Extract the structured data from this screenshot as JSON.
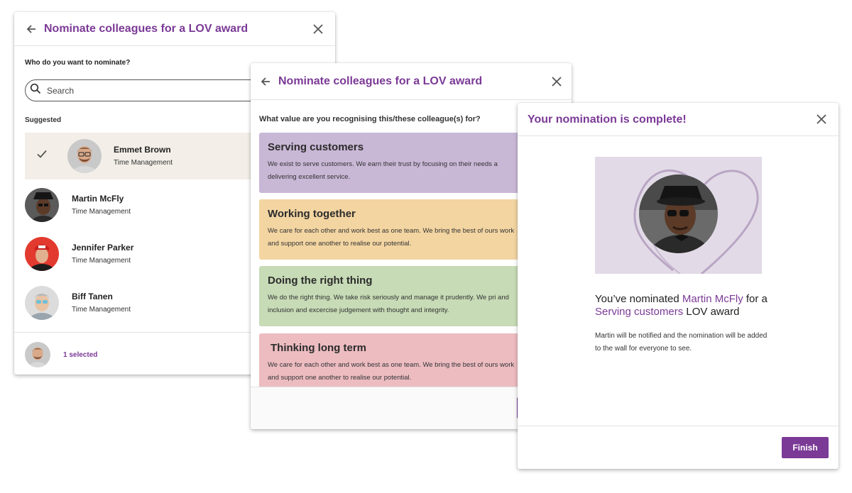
{
  "colors": {
    "brand_purple": "#7b3a96",
    "selected_row": "#f3efe8",
    "serving_card": "#c9b7d6",
    "working_card": "#f3d5a2",
    "right_thing_card": "#c7dbb6",
    "long_term_card": "#ecbcc1",
    "hero_background": "#e2dbe7"
  },
  "panel1": {
    "title": "Nominate colleagues for a LOV award",
    "back_icon": "arrow-left-icon",
    "close_icon": "close-icon",
    "question": "Who do you want to nominate?",
    "search_placeholder": "Search",
    "search_icon": "search-icon",
    "suggested_label": "Suggested",
    "people": [
      {
        "name": "Emmet Brown",
        "department": "Time Management",
        "selected": true
      },
      {
        "name": "Martin McFly",
        "department": "Time Management",
        "selected": false
      },
      {
        "name": "Jennifer Parker",
        "department": "Time Management",
        "selected": false
      },
      {
        "name": "Biff Tanen",
        "department": "Time Management",
        "selected": false
      }
    ],
    "footer_selected": "1 selected"
  },
  "panel2": {
    "title": "Nominate colleagues for a LOV award",
    "question": "What value are you recognising this/these colleague(s) for?",
    "values": [
      {
        "title": "Serving customers",
        "description": "We exist to serve customers. We earn their trust by focusing on their needs a delivering excellent service."
      },
      {
        "title": "Working together",
        "description": "We care for each other and work best as one team. We bring the best of ours work and support one another to realise our potential."
      },
      {
        "title": "Doing the right thing",
        "description": "We do the right thing. We take risk seriously and manage it prudently. We pri and inclusion and excercise judgement with thought and integrity."
      },
      {
        "title": "Thinking long term",
        "description": "We care for each other and work best as one team. We bring the best of ours work and support one another to realise our potential."
      }
    ]
  },
  "panel3": {
    "title": "Your nomination is complete!",
    "close_icon": "close-icon",
    "nominated_prefix": "You’ve nominated ",
    "nominee": "Martin McFly",
    "nominated_middle": " for a ",
    "award_value": "Serving customers",
    "nominated_suffix": " LOV award",
    "notification": "Martin will be notified and the nomination will be added to the wall for everyone to see.",
    "finish_label": "Finish"
  }
}
